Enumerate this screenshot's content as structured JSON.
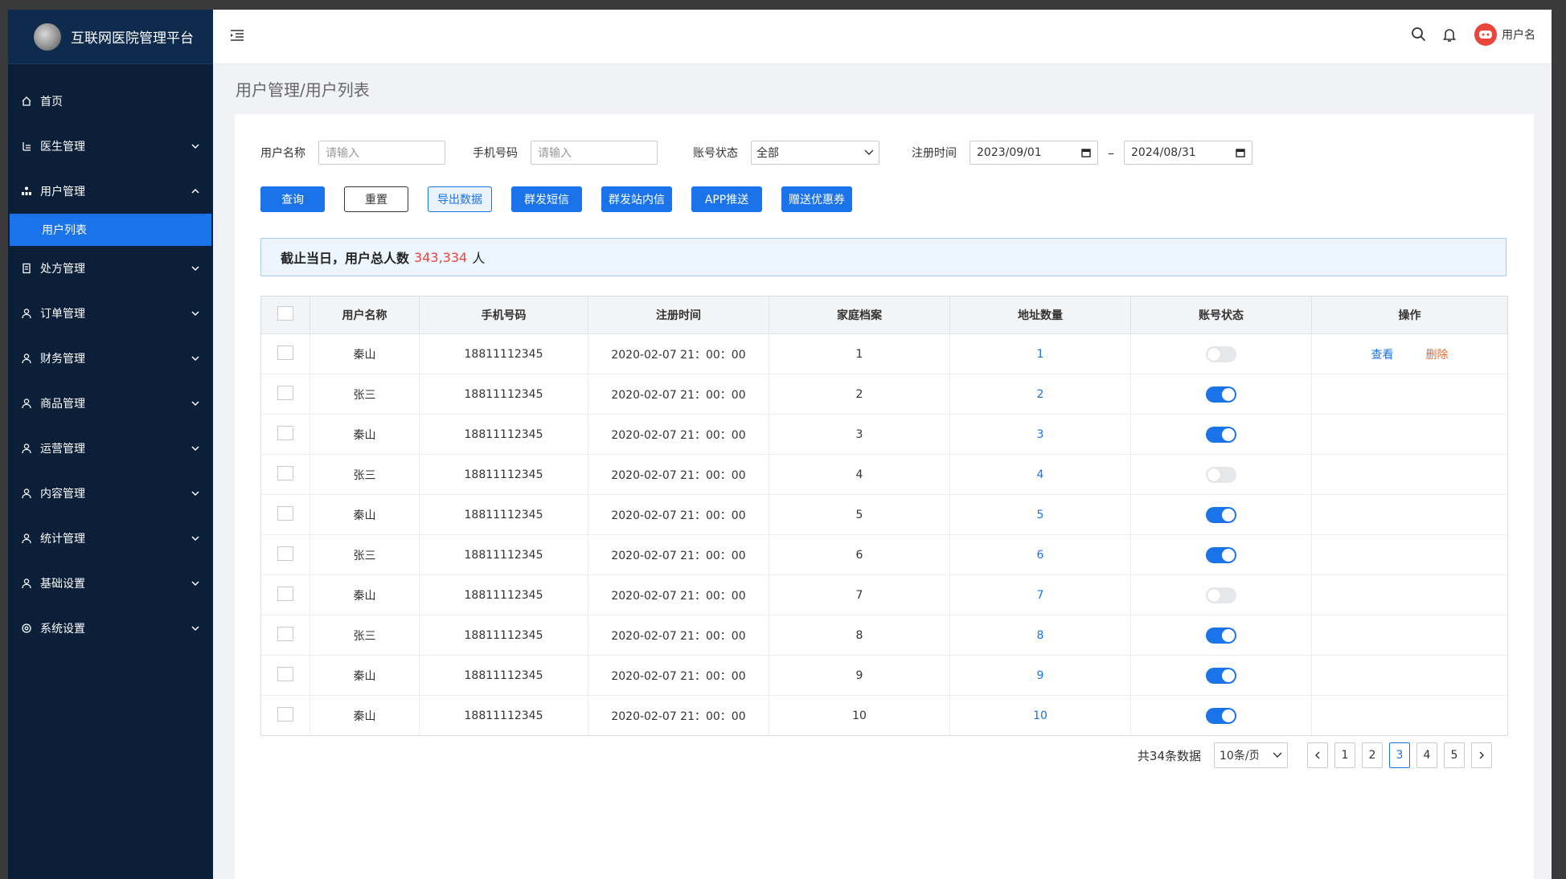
{
  "app": {
    "title": "互联网医院管理平台"
  },
  "sidebar": {
    "items": [
      {
        "label": "首页",
        "icon": "home-icon",
        "has_children": false
      },
      {
        "label": "医生管理",
        "icon": "doctor-icon",
        "has_children": true
      },
      {
        "label": "用户管理",
        "icon": "users-icon",
        "has_children": true,
        "expanded": true,
        "children": [
          {
            "label": "用户列表",
            "active": true
          }
        ]
      },
      {
        "label": "处方管理",
        "icon": "prescription-icon",
        "has_children": true
      },
      {
        "label": "订单管理",
        "icon": "user-icon",
        "has_children": true
      },
      {
        "label": "财务管理",
        "icon": "user-icon",
        "has_children": true
      },
      {
        "label": "商品管理",
        "icon": "user-icon",
        "has_children": true
      },
      {
        "label": "运营管理",
        "icon": "user-icon",
        "has_children": true
      },
      {
        "label": "内容管理",
        "icon": "user-icon",
        "has_children": true
      },
      {
        "label": "统计管理",
        "icon": "user-icon",
        "has_children": true
      },
      {
        "label": "基础设置",
        "icon": "user-icon",
        "has_children": true
      },
      {
        "label": "系统设置",
        "icon": "settings-icon",
        "has_children": true
      }
    ]
  },
  "header": {
    "username": "用户名"
  },
  "breadcrumb": "用户管理/用户列表",
  "filters": {
    "username_label": "用户名称",
    "username_placeholder": "请输入",
    "phone_label": "手机号码",
    "phone_placeholder": "请输入",
    "status_label": "账号状态",
    "status_value": "全部",
    "regtime_label": "注册时间",
    "date_start": "2023/09/01",
    "date_sep": "–",
    "date_end": "2024/08/31"
  },
  "actions": {
    "query": "查询",
    "reset": "重置",
    "export": "导出数据",
    "sms": "群发短信",
    "inbox": "群发站内信",
    "push": "APP推送",
    "coupon": "赠送优惠券"
  },
  "summary": {
    "prefix": "截止当日，用户总人数",
    "count": "343,334",
    "suffix": "人"
  },
  "table": {
    "columns": [
      "用户名称",
      "手机号码",
      "注册时间",
      "家庭档案",
      "地址数量",
      "账号状态",
      "操作"
    ],
    "view_label": "查看",
    "delete_label": "删除",
    "rows": [
      {
        "name": "秦山",
        "phone": "18811112345",
        "time": "2020-02-07 21：00：00",
        "family": "1",
        "address": "1",
        "enabled": false,
        "show_actions": true
      },
      {
        "name": "张三",
        "phone": "18811112345",
        "time": "2020-02-07 21：00：00",
        "family": "2",
        "address": "2",
        "enabled": true,
        "show_actions": false
      },
      {
        "name": "秦山",
        "phone": "18811112345",
        "time": "2020-02-07 21：00：00",
        "family": "3",
        "address": "3",
        "enabled": true,
        "show_actions": false
      },
      {
        "name": "张三",
        "phone": "18811112345",
        "time": "2020-02-07 21：00：00",
        "family": "4",
        "address": "4",
        "enabled": false,
        "show_actions": false
      },
      {
        "name": "秦山",
        "phone": "18811112345",
        "time": "2020-02-07 21：00：00",
        "family": "5",
        "address": "5",
        "enabled": true,
        "show_actions": false
      },
      {
        "name": "张三",
        "phone": "18811112345",
        "time": "2020-02-07 21：00：00",
        "family": "6",
        "address": "6",
        "enabled": true,
        "show_actions": false
      },
      {
        "name": "秦山",
        "phone": "18811112345",
        "time": "2020-02-07 21：00：00",
        "family": "7",
        "address": "7",
        "enabled": false,
        "show_actions": false
      },
      {
        "name": "张三",
        "phone": "18811112345",
        "time": "2020-02-07 21：00：00",
        "family": "8",
        "address": "8",
        "enabled": true,
        "show_actions": false
      },
      {
        "name": "秦山",
        "phone": "18811112345",
        "time": "2020-02-07 21：00：00",
        "family": "9",
        "address": "9",
        "enabled": true,
        "show_actions": false
      },
      {
        "name": "秦山",
        "phone": "18811112345",
        "time": "2020-02-07 21：00：00",
        "family": "10",
        "address": "10",
        "enabled": true,
        "show_actions": false
      }
    ]
  },
  "pagination": {
    "total": "共34条数据",
    "page_size": "10条/页",
    "pages": [
      "1",
      "2",
      "3",
      "4",
      "5"
    ],
    "current": "3"
  },
  "colors": {
    "primary": "#1a73e8",
    "sidebar": "#0b1f38",
    "danger": "#e8453c"
  }
}
